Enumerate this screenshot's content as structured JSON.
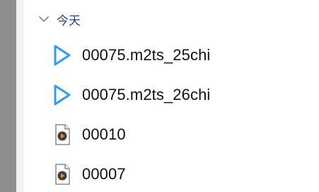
{
  "group": {
    "label": "今天"
  },
  "files": [
    {
      "name": "00075.m2ts_25chi",
      "icon": "play-triangle-icon"
    },
    {
      "name": "00075.m2ts_26chi",
      "icon": "play-triangle-icon"
    },
    {
      "name": "00010",
      "icon": "video-file-icon"
    },
    {
      "name": "00007",
      "icon": "video-file-icon"
    }
  ],
  "colors": {
    "group_text": "#1f3f8f",
    "play_icon": "#2f9bf3",
    "left_strip": "#8e8e8e"
  }
}
